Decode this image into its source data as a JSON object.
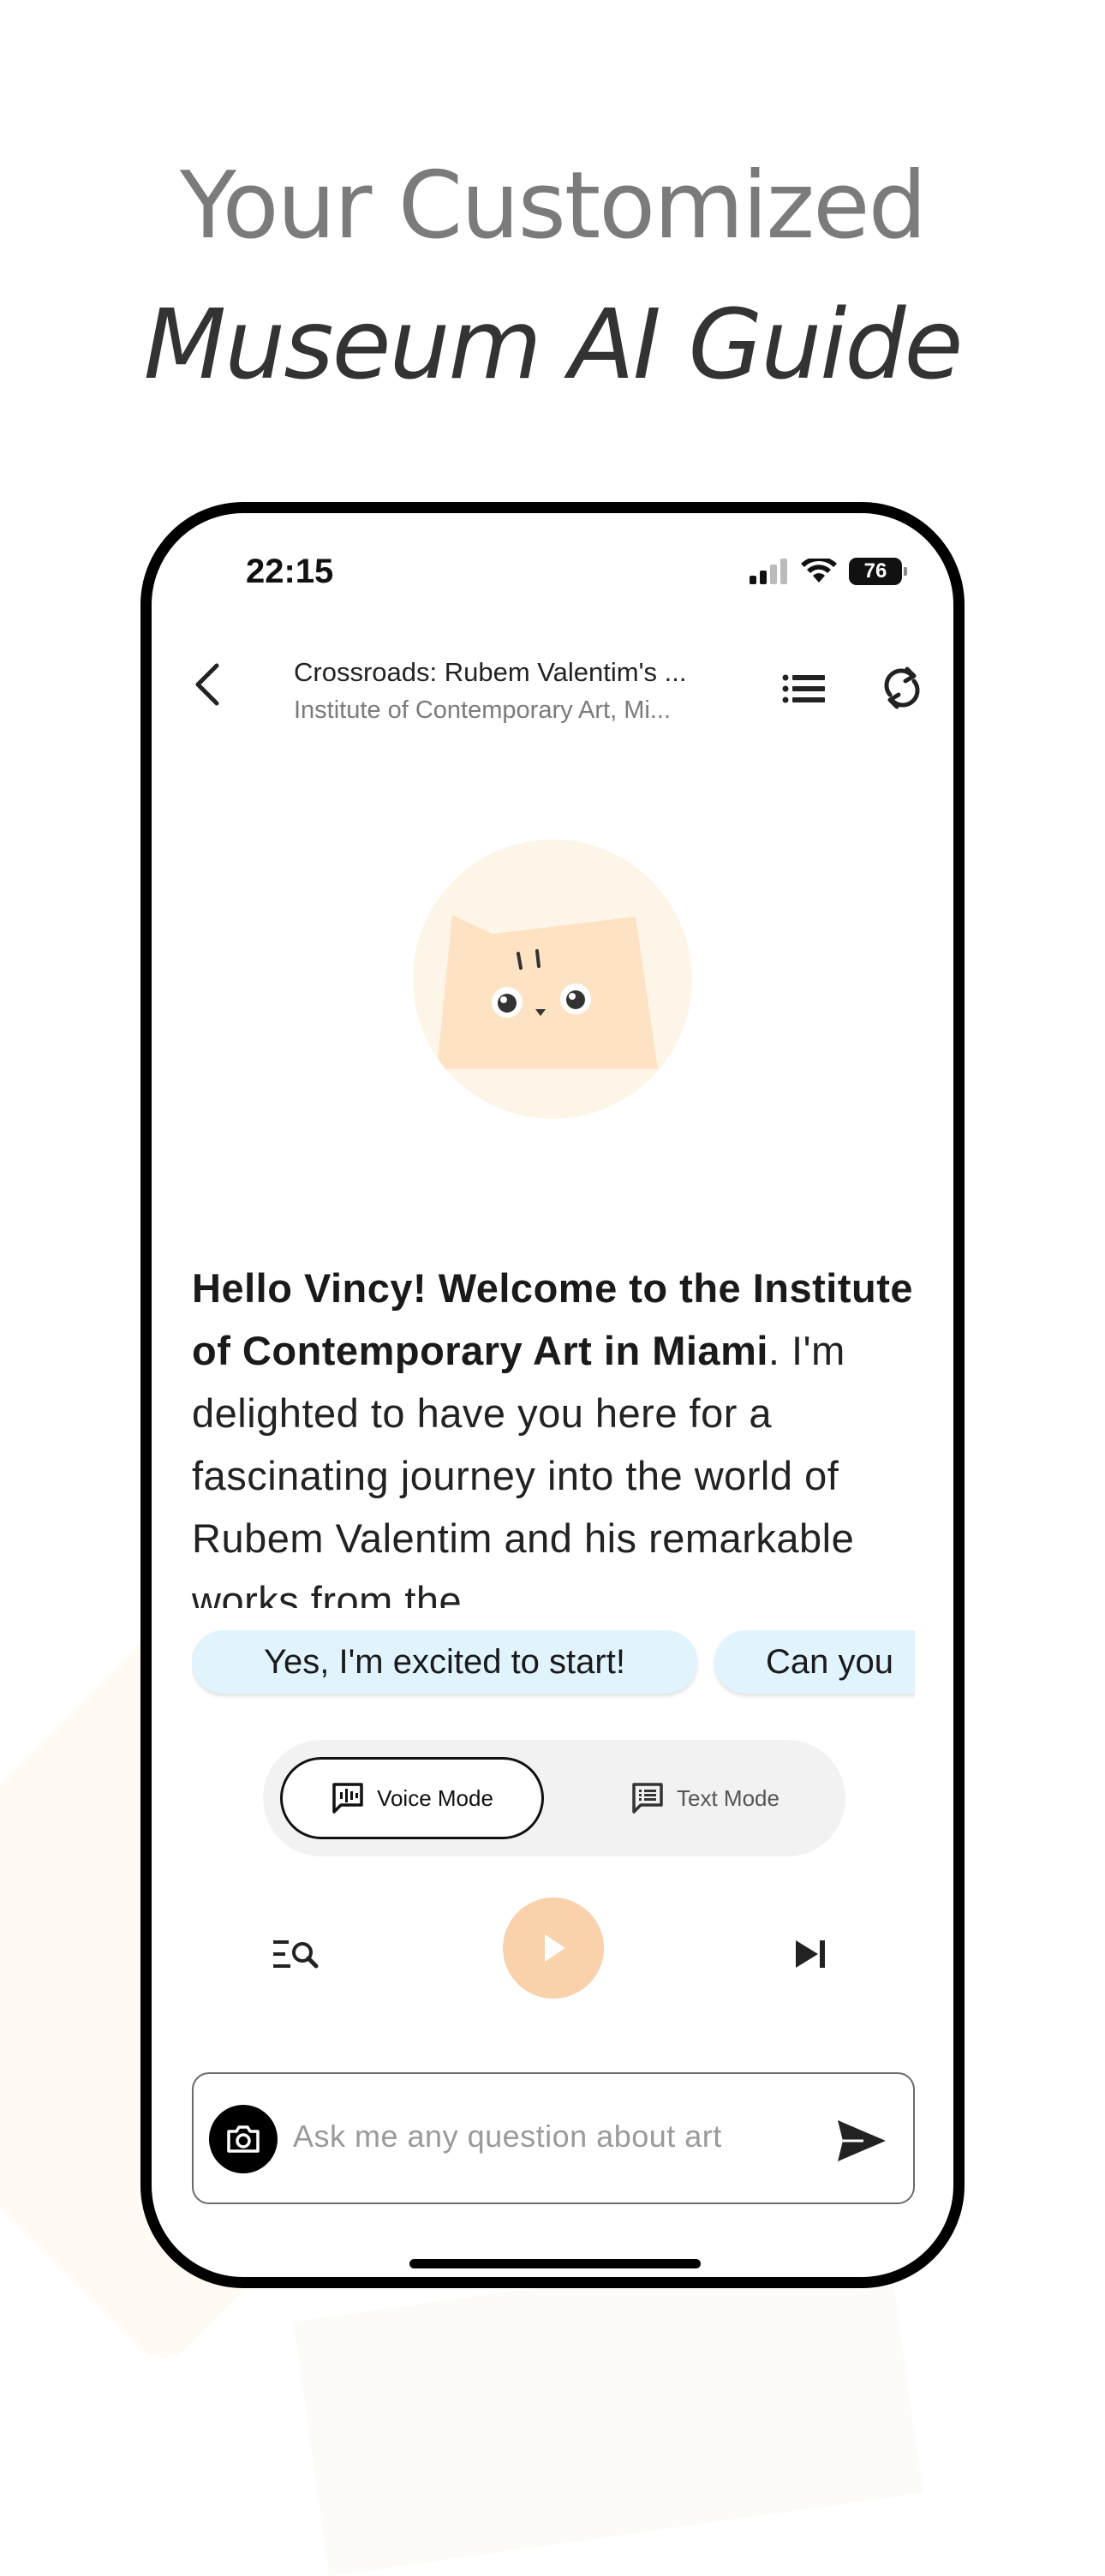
{
  "headline": {
    "line1": "Your Customized",
    "line2": "Museum AI Guide"
  },
  "status_bar": {
    "time": "22:15",
    "battery": "76",
    "icons": [
      "signal-icon",
      "wifi-icon",
      "battery-icon"
    ]
  },
  "header": {
    "title": "Crossroads: Rubem Valentim's ...",
    "subtitle": "Institute of Contemporary Art, Mi...",
    "icons": [
      "back-arrow-icon",
      "list-icon",
      "refresh-icon"
    ]
  },
  "message": {
    "bold_text": "Hello Vincy! Welcome to the Institute of Contemporary Art in Miami",
    "text": ". I'm delighted to have you here for a fascinating journey into the world of Rubem Valentim and his remarkable works from the"
  },
  "suggestions": [
    "Yes, I'm excited to start!",
    "Can you"
  ],
  "modes": {
    "voice_label": "Voice Mode",
    "text_label": "Text Mode",
    "selected": "Voice Mode"
  },
  "controls": {
    "icons": [
      "search-transcript-icon",
      "play-icon",
      "skip-next-icon"
    ]
  },
  "input": {
    "placeholder": "Ask me any question about art",
    "value": ""
  },
  "colors": {
    "headline_gray": "#7b7b7b",
    "headline_dark": "#333333",
    "chip_bg": "#e1f3fd",
    "play_bg": "#f9d1aa",
    "avatar_bg": "#fdf5e8",
    "cat_body": "#fde3c3"
  }
}
